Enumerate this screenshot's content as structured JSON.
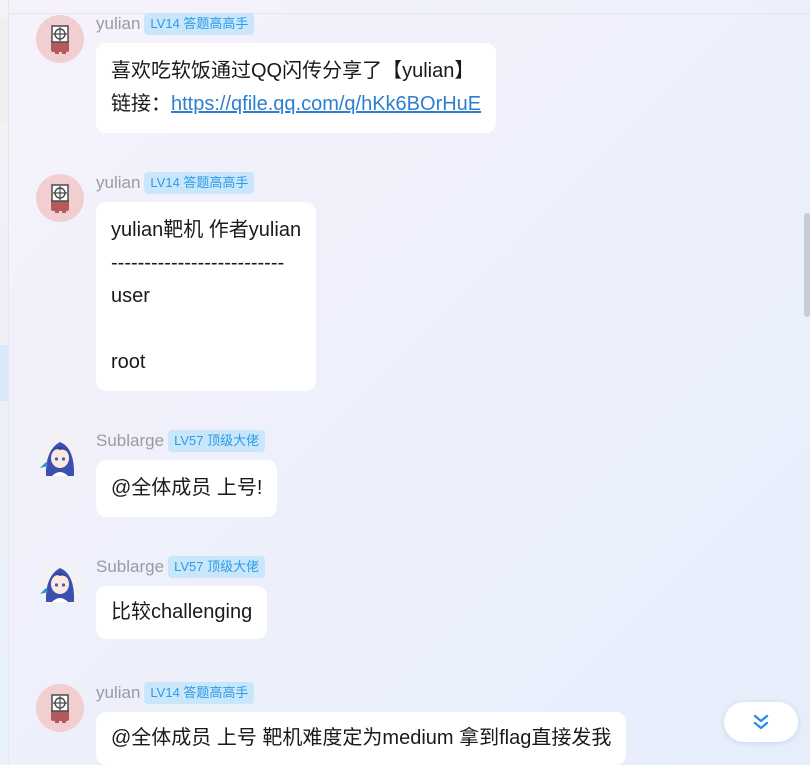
{
  "messages": [
    {
      "nick": "yulian",
      "badge": "LV14 答题高高手",
      "lines": [
        "喜欢吃软饭通过QQ闪传分享了【yulian】"
      ],
      "link_prefix": "链接：",
      "link": "https://qfile.qq.com/q/hKk6BOrHuE"
    },
    {
      "nick": "yulian",
      "badge": "LV14 答题高高手",
      "lines": [
        "yulian靶机  作者yulian",
        "--------------------------",
        "user",
        "",
        "root"
      ]
    },
    {
      "nick": "Sublarge",
      "badge": "LV57 顶级大佬",
      "lines": [
        "@全体成员 上号!"
      ]
    },
    {
      "nick": "Sublarge",
      "badge": "LV57 顶级大佬",
      "lines": [
        "比较challenging"
      ]
    },
    {
      "nick": "yulian",
      "badge": "LV14 答题高高手",
      "lines": [
        "@全体成员 上号 靶机难度定为medium 拿到flag直接发我"
      ]
    }
  ],
  "icons": {
    "avatar_yulian": "target-person-avatar",
    "avatar_sublarge": "anime-girl-avatar",
    "jump_down": "double-chevron-down-icon"
  },
  "colors": {
    "badge_bg": "#c9e6fb",
    "badge_text": "#2e9be6",
    "link": "#2f7fd0",
    "nick": "#9a9aa2"
  }
}
